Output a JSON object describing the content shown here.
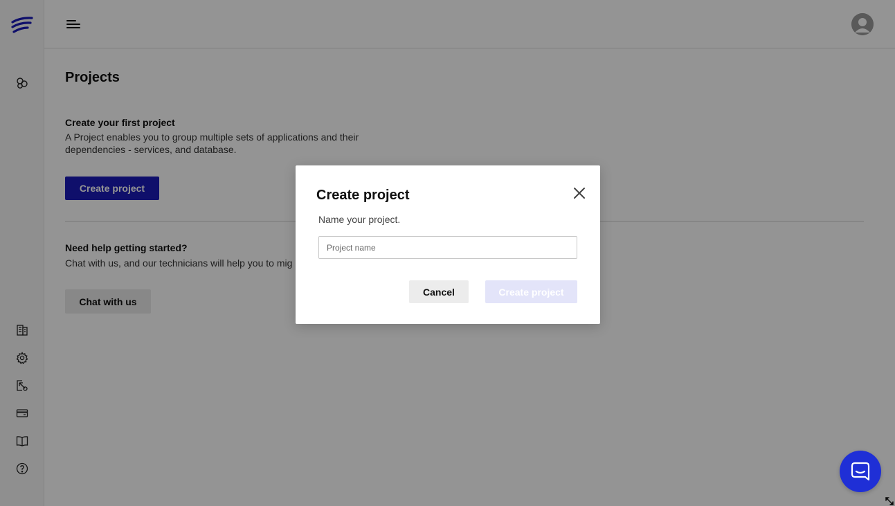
{
  "icons": {
    "logo": "logo-icon",
    "projects": "projects-icon",
    "docs": "documents-icon",
    "settings": "gear-icon",
    "support": "support-icon",
    "billing": "credit-card-icon",
    "guides": "book-icon",
    "help": "help-icon",
    "menu": "hamburger-icon",
    "avatar": "avatar-icon",
    "close": "close-icon",
    "chat": "chat-icon"
  },
  "colors": {
    "primary": "#1b1bb8",
    "primary_disabled": "#e3e4f9",
    "chat_launcher": "#1f2fd6",
    "overlay": "rgba(0,0,0,0.42)"
  },
  "main": {
    "page_title": "Projects",
    "first_project": {
      "title": "Create your first project",
      "description": "A Project enables you to group multiple sets of applications and their dependencies - services, and database.",
      "button_label": "Create project"
    },
    "help": {
      "title": "Need help getting started?",
      "description": "Chat with us, and our technicians will help you to mig",
      "button_label": "Chat with us"
    }
  },
  "modal": {
    "title": "Create project",
    "subtitle": "Name your project.",
    "input_placeholder": "Project name",
    "input_value": "",
    "cancel_label": "Cancel",
    "create_label": "Create project"
  }
}
